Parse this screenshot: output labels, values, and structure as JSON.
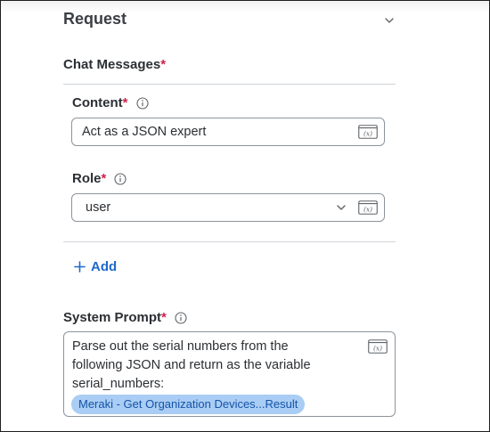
{
  "request": {
    "title": "Request",
    "chat_messages": {
      "label": "Chat Messages",
      "required_mark": "*",
      "content": {
        "label": "Content",
        "required_mark": "*",
        "value": "Act as a JSON expert"
      },
      "role": {
        "label": "Role",
        "required_mark": "*",
        "value": "user"
      },
      "add_label": "Add"
    },
    "system_prompt": {
      "label": "System Prompt",
      "required_mark": "*",
      "text_lines": [
        "Parse out the serial numbers from the",
        "following JSON and return as the variable",
        "serial_numbers:"
      ],
      "variable_chip": "Meraki - Get Organization Devices...Result"
    }
  },
  "icons": {
    "collapse": "chevron-down-icon",
    "info": "info-icon",
    "variable": "variable-icon",
    "add": "plus-icon"
  },
  "colors": {
    "required": "#d0214b",
    "link": "#1d69cc",
    "chip_bg": "#a9cdf4",
    "chip_text": "#1553a8"
  }
}
